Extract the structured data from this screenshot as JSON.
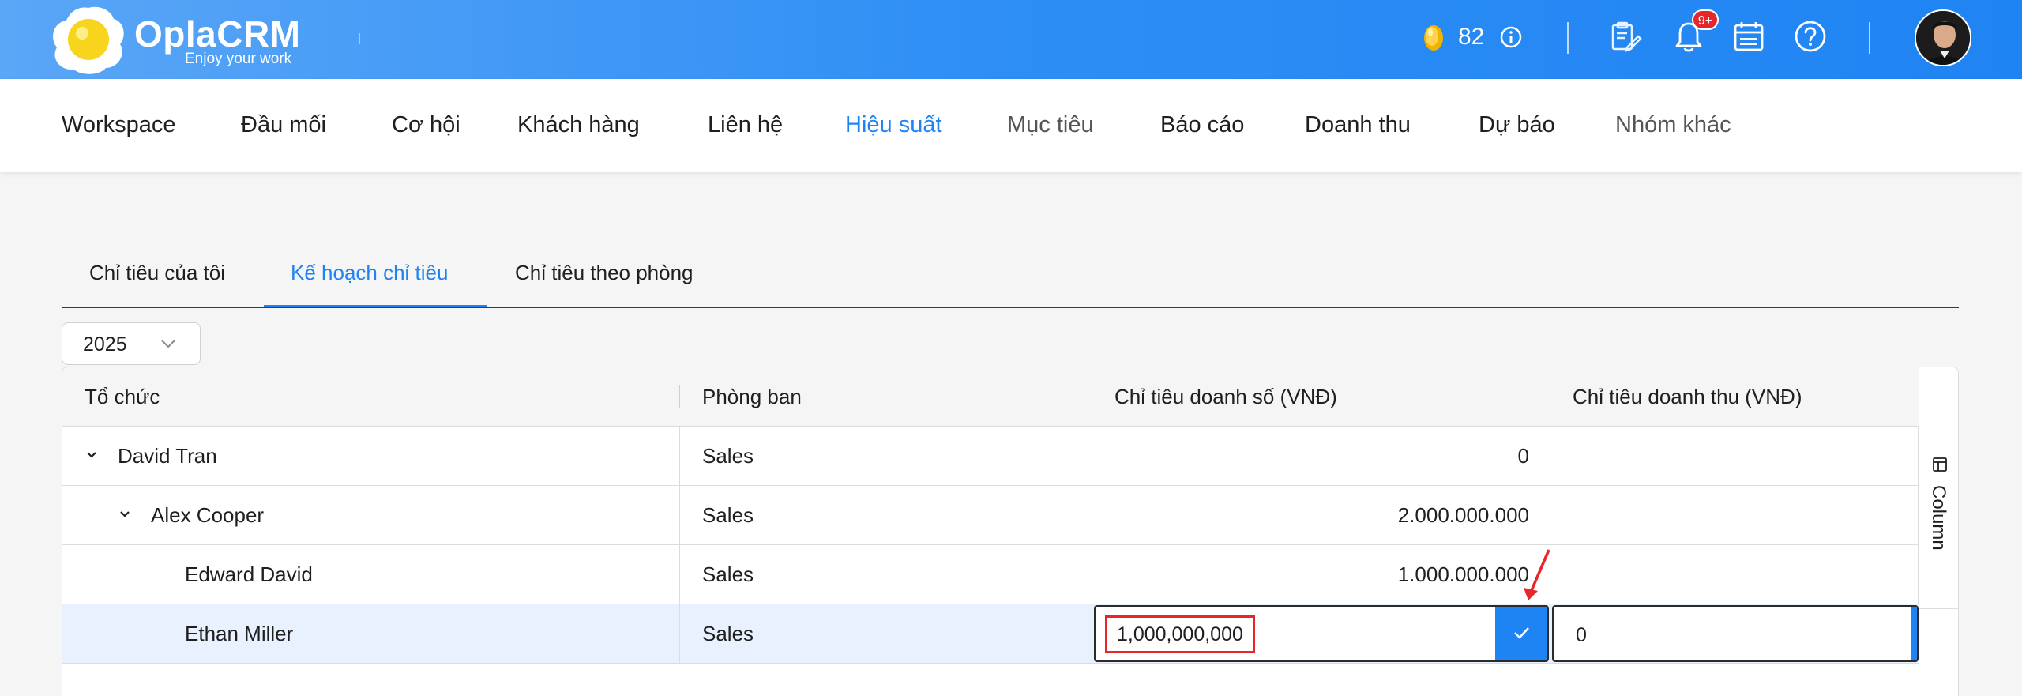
{
  "header": {
    "brand": "OplaCRM",
    "tagline": "Enjoy your work",
    "coins": "82",
    "notification_badge": "9+",
    "colors": {
      "header_blue": "#1f84f3",
      "badge_red": "#e7262b"
    }
  },
  "nav": {
    "items": [
      {
        "label": "Workspace",
        "state": "normal"
      },
      {
        "label": "Đầu mối",
        "state": "normal"
      },
      {
        "label": "Cơ hội",
        "state": "normal"
      },
      {
        "label": "Khách hàng",
        "state": "normal"
      },
      {
        "label": "Liên hệ",
        "state": "normal"
      },
      {
        "label": "Hiệu suất",
        "state": "active"
      },
      {
        "label": "Mục tiêu",
        "state": "muted"
      },
      {
        "label": "Báo cáo",
        "state": "normal"
      },
      {
        "label": "Doanh thu",
        "state": "normal"
      },
      {
        "label": "Dự báo",
        "state": "normal"
      },
      {
        "label": "Nhóm khác",
        "state": "muted"
      }
    ]
  },
  "tabs": [
    {
      "label": "Chỉ tiêu của tôi",
      "active": false
    },
    {
      "label": "Kế hoạch chỉ tiêu",
      "active": true
    },
    {
      "label": "Chỉ tiêu theo phòng",
      "active": false
    }
  ],
  "year_select": {
    "value": "2025"
  },
  "table": {
    "columns": [
      "Tổ chức",
      "Phòng ban",
      "Chỉ tiêu doanh số (VNĐ)",
      "Chỉ tiêu doanh thu (VNĐ)"
    ],
    "rows": [
      {
        "name": "David Tran",
        "department": "Sales",
        "sales_target": "0",
        "revenue_target": "",
        "expandable": true,
        "level": 0
      },
      {
        "name": "Alex Cooper",
        "department": "Sales",
        "sales_target": "2.000.000.000",
        "revenue_target": "",
        "expandable": true,
        "level": 1
      },
      {
        "name": "Edward David",
        "department": "Sales",
        "sales_target": "1.000.000.000",
        "revenue_target": "",
        "expandable": false,
        "level": 2
      },
      {
        "name": "Ethan Miller",
        "department": "Sales",
        "sales_target": "1,000,000,000",
        "revenue_target": "0",
        "expandable": false,
        "level": 2,
        "editing": true
      }
    ],
    "column_panel_label": "Column"
  },
  "icons": [
    "logo-egg-icon",
    "coin-icon",
    "info-icon",
    "clipboard-icon",
    "bell-icon",
    "calendar-icon",
    "help-icon",
    "chevron-down-icon",
    "caret-down-icon",
    "check-icon",
    "table-columns-icon",
    "red-arrow-annotation"
  ]
}
